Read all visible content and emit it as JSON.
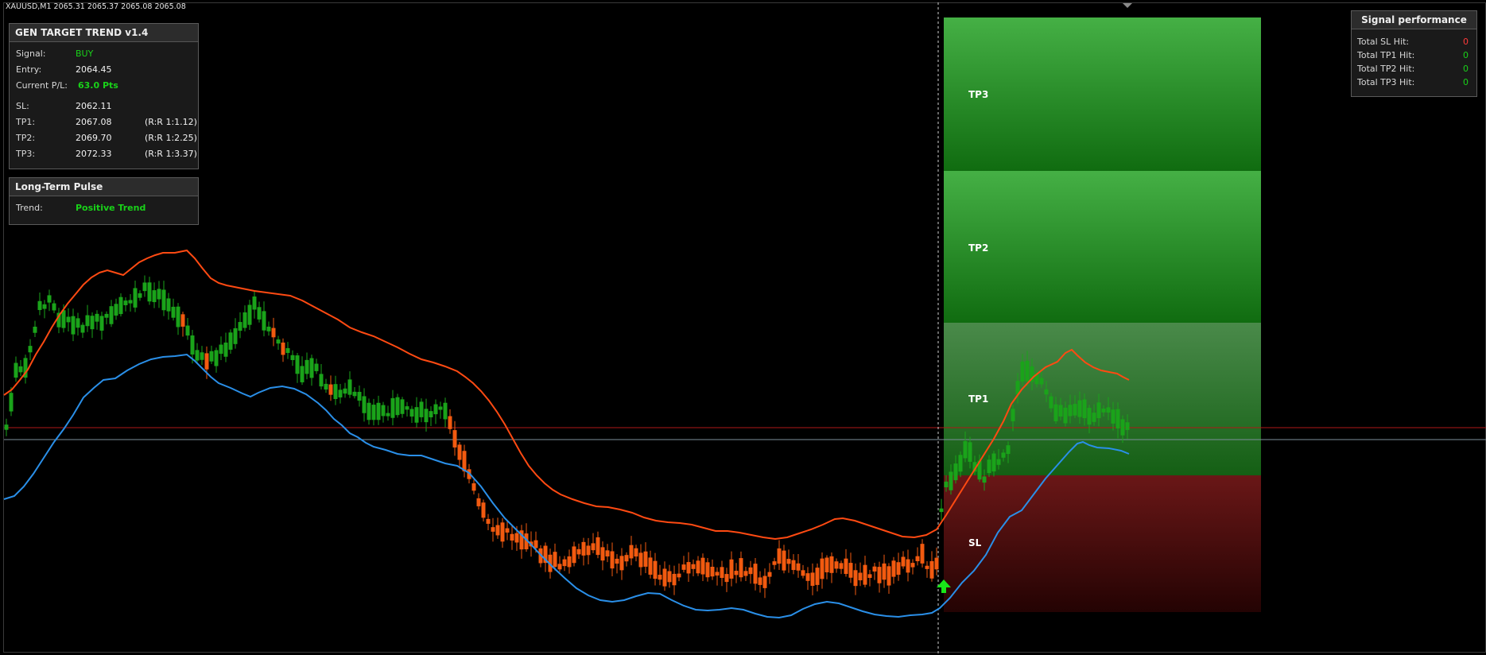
{
  "header": {
    "symbol_line": "XAUUSD,M1  2065.31 2065.37 2065.08 2065.08"
  },
  "signal_panel": {
    "title": "GEN TARGET TREND v1.4",
    "signal_label": "Signal:",
    "signal_value": "BUY",
    "entry_label": "Entry:",
    "entry_value": "2064.45",
    "pl_label": "Current P/L:",
    "pl_value": "63.0 Pts",
    "sl_label": "SL:",
    "sl_value": "2062.11",
    "tp1_label": "TP1:",
    "tp1_value": "2067.08",
    "tp1_rr": "(R:R 1:1.12)",
    "tp2_label": "TP2:",
    "tp2_value": "2069.70",
    "tp2_rr": "(R:R 1:2.25)",
    "tp3_label": "TP3:",
    "tp3_value": "2072.33",
    "tp3_rr": "(R:R 1:3.37)"
  },
  "pulse_panel": {
    "title": "Long-Term Pulse",
    "trend_label": "Trend:",
    "trend_value": "Positive Trend"
  },
  "performance_panel": {
    "title": "Signal performance",
    "sl_hit_label": "Total SL Hit:",
    "sl_hit_value": "0",
    "tp1_hit_label": "Total TP1 Hit:",
    "tp1_hit_value": "0",
    "tp2_hit_label": "Total TP2 Hit:",
    "tp2_hit_value": "0",
    "tp3_hit_label": "Total TP3 Hit:",
    "tp3_hit_value": "0"
  },
  "zones": {
    "tp3": "TP3",
    "tp2": "TP2",
    "tp1": "TP1",
    "sl": "SL"
  },
  "colors": {
    "bull": "#1aa31a",
    "bear": "#f25a10",
    "upper_band": "#ff4a12",
    "lower_band": "#2a8fe8",
    "signal_arrow": "#19e619",
    "entry_line": "#b01818",
    "price_line": "#7e8f9c"
  },
  "icons": {
    "signal": "buy-arrow-icon"
  }
}
